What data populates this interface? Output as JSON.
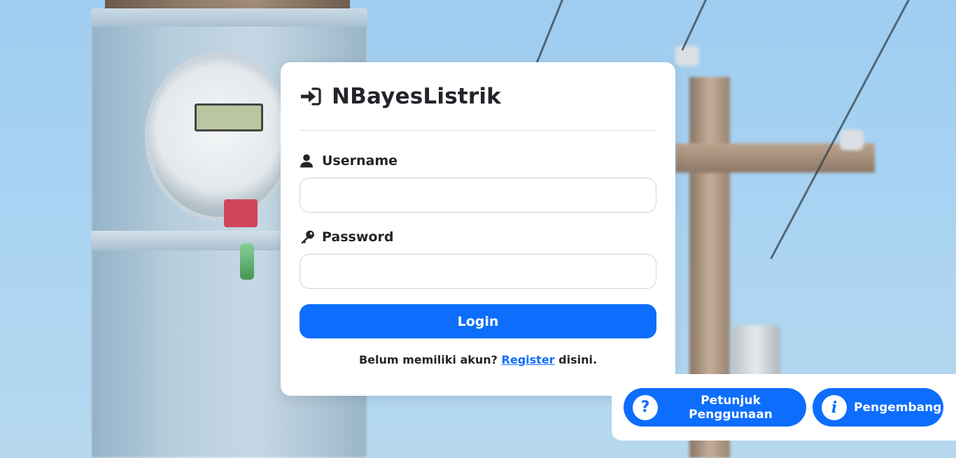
{
  "app": {
    "title": "NBayesListrik"
  },
  "form": {
    "username_label": "Username",
    "username_value": "",
    "username_placeholder": "",
    "password_label": "Password",
    "password_value": "",
    "password_placeholder": "",
    "login_label": "Login"
  },
  "register": {
    "prefix": "Belum memiliki akun?",
    "link_label": "Register",
    "suffix": "disini."
  },
  "help_panel": {
    "guide_label": "Petunjuk Penggunaan",
    "guide_icon": "question-circle-icon",
    "developer_label": "Pengembang",
    "developer_icon": "info-circle-icon"
  },
  "colors": {
    "primary": "#0d6efd",
    "card_background": "#ffffff",
    "text": "#222529",
    "sky": "#a9d3f2"
  }
}
